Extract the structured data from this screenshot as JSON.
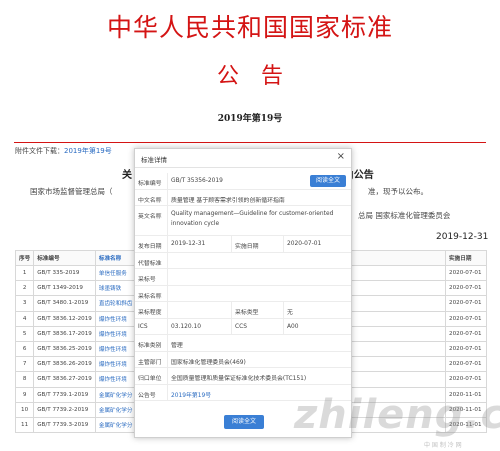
{
  "page": {
    "title": "中华人民共和国国家标准",
    "subtitle": "公告",
    "notice_no": "2019年第19号",
    "attachment_label": "附件文件下载：",
    "attachment_link": "2019年第19号",
    "heading_left": "关",
    "heading_right": "J公告",
    "para_left": "国家市场监督管理总局（",
    "para_right": "准，现予以公布。",
    "signature": "总局 国家标准化管理委员会",
    "date": "2019-12-31"
  },
  "table": {
    "headers": [
      "序号",
      "标准编号",
      "标准名称",
      "",
      "实施日期"
    ],
    "rows": [
      {
        "no": "1",
        "code": "GB/T 335-2019",
        "name": "单信任服务",
        "rep": "19",
        "date": "2020-07-01"
      },
      {
        "no": "2",
        "code": "GB/T 1349-2019",
        "name": "球墨铸铁",
        "rep": "39",
        "date": "2020-07-01"
      },
      {
        "no": "3",
        "code": "GB/T 3480.1-2019",
        "name": "直齿轮和斜齿",
        "rep": "3T 3480-1997",
        "date": "2020-07-01"
      },
      {
        "no": "4",
        "code": "GB/T 3836.12-2019",
        "name": "爆炸性环境",
        "rep": "2010,GB/T 12476.9-2010,GB/T",
        "date": "2020-07-01"
      },
      {
        "no": "5",
        "code": "GB/T 3836.17-2019",
        "name": "爆炸性环境",
        "rep": "007",
        "date": "2020-07-01"
      },
      {
        "no": "6",
        "code": "GB/T 3836.25-2019",
        "name": "爆炸性环境",
        "rep": "",
        "date": "2020-07-01"
      },
      {
        "no": "7",
        "code": "GB/T 3836.26-2019",
        "name": "爆炸性环境",
        "rep": "",
        "date": "2020-07-01"
      },
      {
        "no": "8",
        "code": "GB/T 3836.27-2019",
        "name": "爆炸性环境",
        "rep": "",
        "date": "2020-07-01"
      },
      {
        "no": "9",
        "code": "GB/T 7739.1-2019",
        "name": "金属矿化学分",
        "rep": "007",
        "date": "2020-11-01"
      },
      {
        "no": "10",
        "code": "GB/T 7739.2-2019",
        "name": "金属矿化学分",
        "rep": "007",
        "date": "2020-11-01"
      },
      {
        "no": "11",
        "code": "GB/T 7739.3-2019",
        "name": "金属矿化学分",
        "rep": "007",
        "date": "2020-11-01"
      }
    ]
  },
  "modal": {
    "title": "标准详情",
    "close_icon": "close-icon",
    "fields": {
      "std_no_label": "标准编号",
      "std_no": "GB/T 35356-2019",
      "read_full_label": "阅读全文",
      "cn_name_label": "中文名称",
      "cn_name": "质量管理 基于顾客需求引领的创新循环指南",
      "en_name_label": "英文名称",
      "en_name": "Quality management—Guideline for customer-oriented innovation cycle",
      "publish_label": "发布日期",
      "publish": "2019-12-31",
      "impl_label": "实施日期",
      "impl": "2020-07-01",
      "replace_label": "代替标准",
      "replace": "",
      "adopt_no_label": "采标号",
      "adopt_no": "",
      "adopt_name_label": "采标名称",
      "adopt_name": "",
      "adopt_degree_label": "采标程度",
      "adopt_degree": "",
      "adopt_type_label": "采标类型",
      "adopt_type": "无",
      "ics_label": "ICS",
      "ics": "03.120.10",
      "ccs_label": "CCS",
      "ccs": "A00",
      "category_label": "标准类别",
      "category": "管理",
      "dept_label": "主管部门",
      "dept": "国家标准化管理委员会(469)",
      "unit_label": "归口单位",
      "unit": "全国质量管理和质量保证标准化技术委员会(TC151)",
      "notice_label": "公告号",
      "notice": "2019年第19号"
    }
  },
  "watermark": {
    "text": "zhileng.com",
    "sub": "中 国 制 冷 网"
  }
}
